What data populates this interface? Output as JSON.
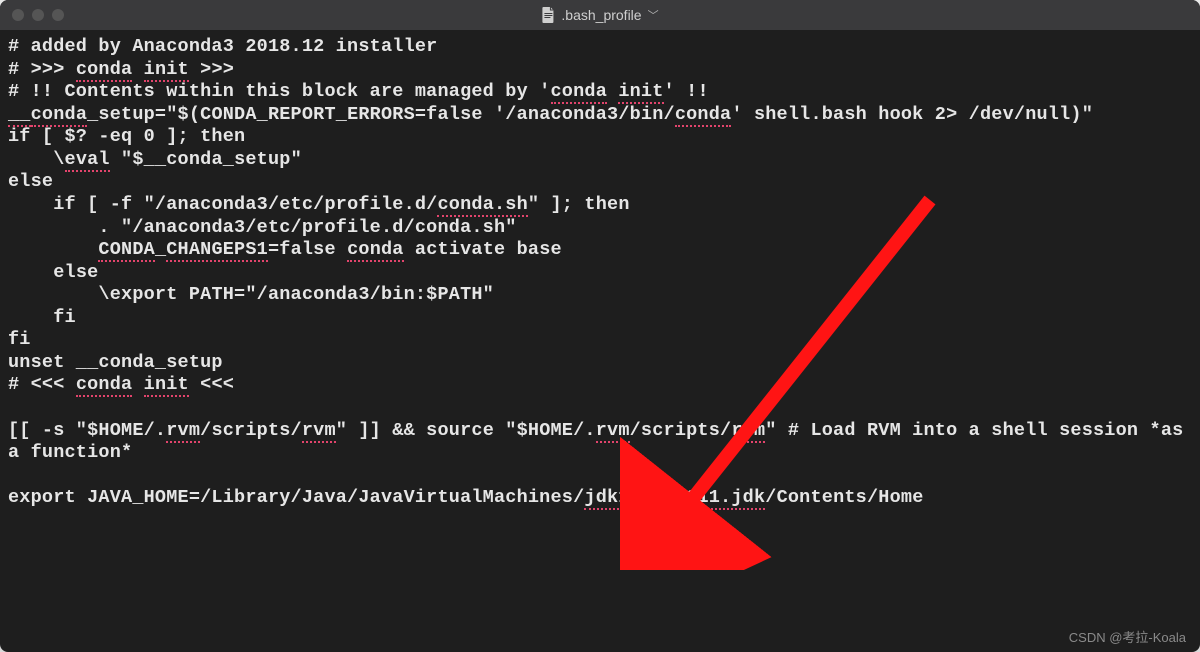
{
  "titlebar": {
    "filename": ".bash_profile"
  },
  "watermark": "CSDN @考拉-Koala",
  "arrow": {
    "color": "#ff1414"
  },
  "lines": [
    {
      "segs": [
        {
          "t": "# added by Anaconda3 2018.12 installer"
        }
      ]
    },
    {
      "segs": [
        {
          "t": "# >>> "
        },
        {
          "t": "conda",
          "sq": true
        },
        {
          "t": " "
        },
        {
          "t": "init",
          "sq": true
        },
        {
          "t": " >>>"
        }
      ]
    },
    {
      "segs": [
        {
          "t": "# !! Contents within this block are managed by '"
        },
        {
          "t": "conda",
          "sq": true
        },
        {
          "t": " "
        },
        {
          "t": "init",
          "sq": true
        },
        {
          "t": "' !!"
        }
      ]
    },
    {
      "segs": [
        {
          "t": "__",
          "sq": true
        },
        {
          "t": "conda",
          "sq": true
        },
        {
          "t": "_setup=\"$(CONDA_REPORT_ERRORS=false '/anaconda3/bin/"
        },
        {
          "t": "conda",
          "sq": true
        },
        {
          "t": "' shell.bash hook 2> /dev/null)\""
        }
      ]
    },
    {
      "segs": [
        {
          "t": "if [ $? -eq 0 ]; then"
        }
      ]
    },
    {
      "segs": [
        {
          "t": "    \\"
        },
        {
          "t": "eval",
          "sq": true
        },
        {
          "t": " \"$__conda_setup\""
        }
      ]
    },
    {
      "segs": [
        {
          "t": "else"
        }
      ]
    },
    {
      "segs": [
        {
          "t": "    if [ -f \"/anaconda3/etc/profile.d/"
        },
        {
          "t": "conda.sh",
          "sq": true
        },
        {
          "t": "\" ]; then"
        }
      ]
    },
    {
      "segs": [
        {
          "t": "        . \"/anaconda3/etc/profile.d/conda.sh\""
        }
      ]
    },
    {
      "segs": [
        {
          "t": "        "
        },
        {
          "t": "CONDA",
          "sq": true
        },
        {
          "t": "_"
        },
        {
          "t": "CHANGEPS1",
          "sq": true
        },
        {
          "t": "=false "
        },
        {
          "t": "conda",
          "sq": true
        },
        {
          "t": " activate base"
        }
      ]
    },
    {
      "segs": [
        {
          "t": "    else"
        }
      ]
    },
    {
      "segs": [
        {
          "t": "        \\export PATH=\"/anaconda3/bin:$PATH\""
        }
      ]
    },
    {
      "segs": [
        {
          "t": "    fi"
        }
      ]
    },
    {
      "segs": [
        {
          "t": "fi"
        }
      ]
    },
    {
      "segs": [
        {
          "t": "unset __conda_setup"
        }
      ]
    },
    {
      "segs": [
        {
          "t": "# <<< "
        },
        {
          "t": "conda",
          "sq": true
        },
        {
          "t": " "
        },
        {
          "t": "init",
          "sq": true
        },
        {
          "t": " <<<"
        }
      ]
    },
    {
      "segs": [
        {
          "t": " "
        }
      ]
    },
    {
      "segs": [
        {
          "t": "[[ -s \"$HOME/."
        },
        {
          "t": "rvm",
          "sq": true
        },
        {
          "t": "/scripts/"
        },
        {
          "t": "rvm",
          "sq": true
        },
        {
          "t": "\" ]] && source \"$HOME/."
        },
        {
          "t": "rvm",
          "sq": true
        },
        {
          "t": "/scripts/"
        },
        {
          "t": "rvm",
          "sq": true
        },
        {
          "t": "\" # Load RVM into a shell session *as a function*"
        }
      ]
    },
    {
      "segs": [
        {
          "t": " "
        }
      ]
    },
    {
      "segs": [
        {
          "t": "export JAVA_HOME=/Library/Java/JavaVirtualMachines/"
        },
        {
          "t": "jdk1.8.0",
          "sq": true
        },
        {
          "t": "_"
        },
        {
          "t": "211.jdk",
          "sq": true
        },
        {
          "t": "/Contents/Home"
        }
      ]
    }
  ]
}
